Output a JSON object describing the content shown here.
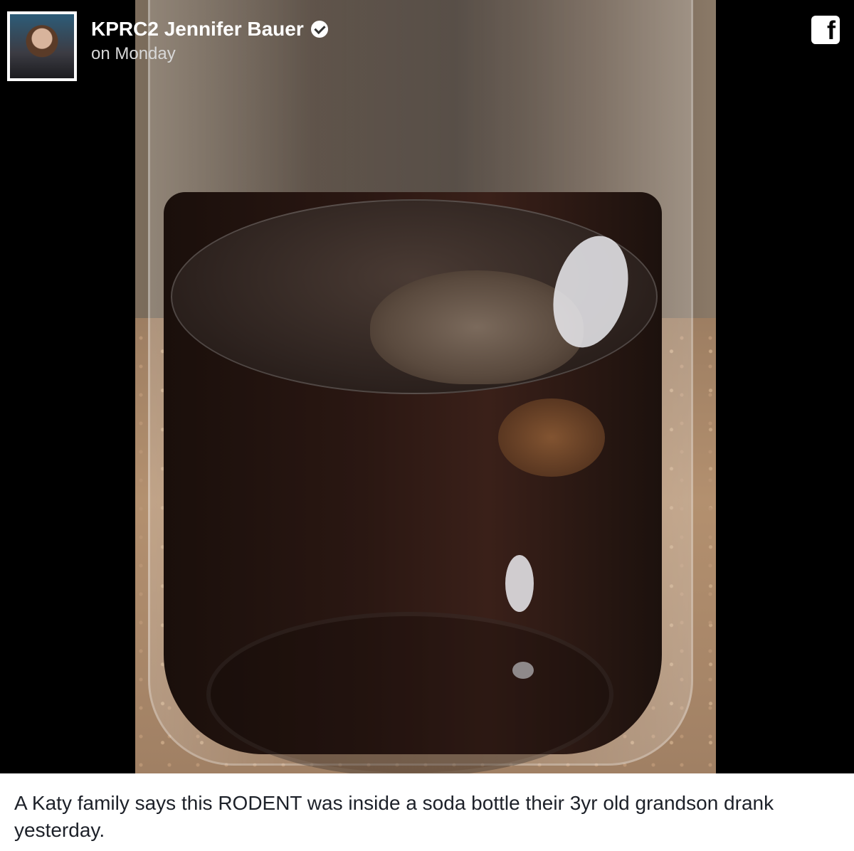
{
  "post": {
    "author": "KPRC2 Jennifer Bauer",
    "time": "on Monday",
    "caption": "A Katy family says this RODENT was inside a soda bottle their 3yr old grandson drank yesterday."
  },
  "icons": {
    "platform": "facebook-icon",
    "verified": "verified-badge-icon"
  },
  "colors": {
    "embed_background": "#000000",
    "caption_text": "#1d2129"
  }
}
